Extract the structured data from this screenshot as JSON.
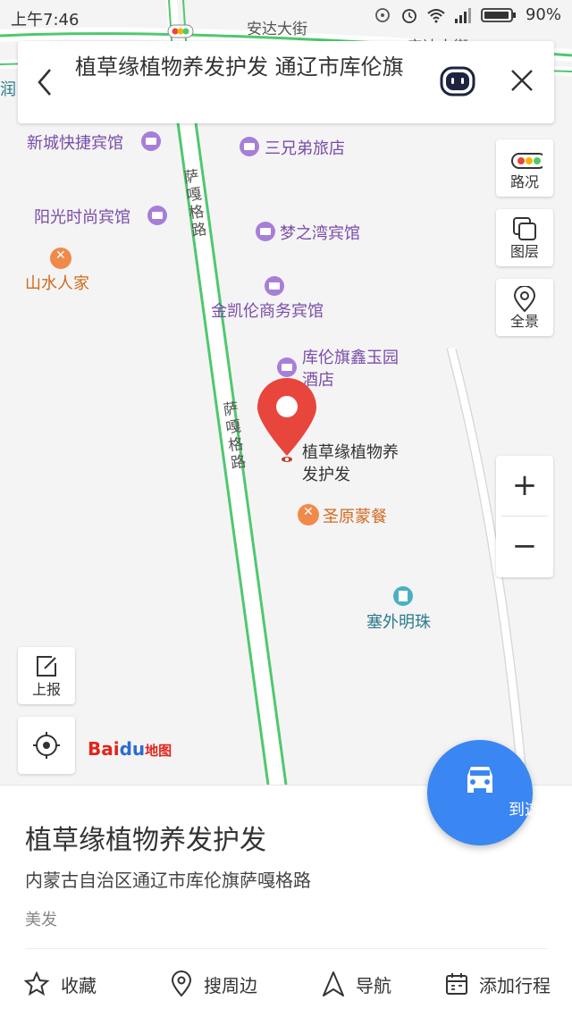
{
  "status_bar": {
    "time": "上午7:46",
    "battery": "90%"
  },
  "search": {
    "query": "植草缘植物养发护发 通辽市库伦旗"
  },
  "map": {
    "streets": {
      "top_street_1": "安达大街",
      "top_street_2": "安达大街",
      "road_upper": "萨嘎格路",
      "road_lower": "萨嘎格路"
    },
    "pois": {
      "xincheng": "新城快捷宾馆",
      "sanxiongdi": "三兄弟旅店",
      "yangguang": "阳光时尚宾馆",
      "mengzhiwan": "梦之湾宾馆",
      "shanshui": "山水人家",
      "jinkailun": "金凯伦商务宾馆",
      "kulunqi_line1": "库伦旗鑫玉园",
      "kulunqi_line2": "酒店",
      "target_line1": "植草缘植物养",
      "target_line2": "发护发",
      "shengyuan": "圣原蒙餐",
      "saiwai": "塞外明珠",
      "edge_left": "润"
    }
  },
  "controls": {
    "traffic": "路况",
    "layers": "图层",
    "panorama": "全景",
    "zoom_in": "+",
    "zoom_out": "−",
    "report": "上报"
  },
  "branding": {
    "bai": "Bai",
    "du": "du",
    "ditu": "地图"
  },
  "go_button": "到这去",
  "place": {
    "name": "植草缘植物养发护发",
    "address": "内蒙古自治区通辽市库伦旗萨嘎格路",
    "category": "美发"
  },
  "actions": {
    "favorite": "收藏",
    "nearby": "搜周边",
    "navigate": "导航",
    "add_trip": "添加行程"
  },
  "colors": {
    "accent_blue": "#3a86f2",
    "pin_red": "#e8453c",
    "hotel_purple": "#7a4ca8",
    "food_orange": "#d2691e",
    "road_green": "#4fc86e"
  }
}
